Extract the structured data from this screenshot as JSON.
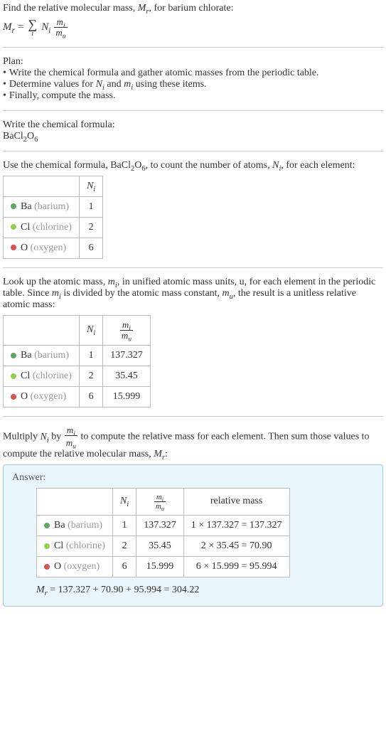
{
  "intro": {
    "line1_a": "Find the relative molecular mass, ",
    "line1_b": ", for barium chlorate:"
  },
  "eq": {
    "Mr": "M",
    "Mr_sub": "r",
    "eq": " = ",
    "sigma_sub": "i",
    "Ni": "N",
    "Ni_sub": "i",
    "frac_num_m": "m",
    "frac_num_sub": "i",
    "frac_den_m": "m",
    "frac_den_sub": "u"
  },
  "plan": {
    "title": "Plan:",
    "items": [
      "Write the chemical formula and gather atomic masses from the periodic table.",
      "Determine values for Nᵢ and mᵢ using these items.",
      "Finally, compute the mass."
    ],
    "item1_a": "Determine values for ",
    "item1_b": " and ",
    "item1_c": " using these items."
  },
  "write_formula": {
    "title": "Write the chemical formula:",
    "formula_parts": [
      "BaCl",
      "2",
      "O",
      "6"
    ]
  },
  "count": {
    "text_a": "Use the chemical formula, ",
    "text_b": ", to count the number of atoms, ",
    "text_c": ", for each element:"
  },
  "table_headers": {
    "Ni": "N",
    "Ni_sub": "i",
    "ratio_num": "m",
    "ratio_num_sub": "i",
    "ratio_den": "m",
    "ratio_den_sub": "u",
    "relmass": "relative mass"
  },
  "elements": [
    {
      "sym": "Ba",
      "name": "(barium)",
      "color": "#5fa85f",
      "N": "1",
      "mass": "137.327",
      "rel": "1 × 137.327 = 137.327"
    },
    {
      "sym": "Cl",
      "name": "(chlorine)",
      "color": "#8fd14f",
      "N": "2",
      "mass": "35.45",
      "rel": "2 × 35.45 = 70.90"
    },
    {
      "sym": "O",
      "name": "(oxygen)",
      "color": "#d9534f",
      "N": "6",
      "mass": "15.999",
      "rel": "6 × 15.999 = 95.994"
    }
  ],
  "lookup": {
    "text_a": "Look up the atomic mass, ",
    "text_b": ", in unified atomic mass units, u, for each element in the periodic table. Since ",
    "text_c": " is divided by the atomic mass constant, ",
    "text_d": ", the result is a unitless relative atomic mass:"
  },
  "multiply": {
    "text_a": "Multiply ",
    "text_b": " by ",
    "text_c": " to compute the relative mass for each element. Then sum those values to compute the relative molecular mass, ",
    "text_d": ":"
  },
  "answer": {
    "label": "Answer:",
    "final_a": " = 137.327 + 70.90 + 95.994 = 304.22"
  }
}
